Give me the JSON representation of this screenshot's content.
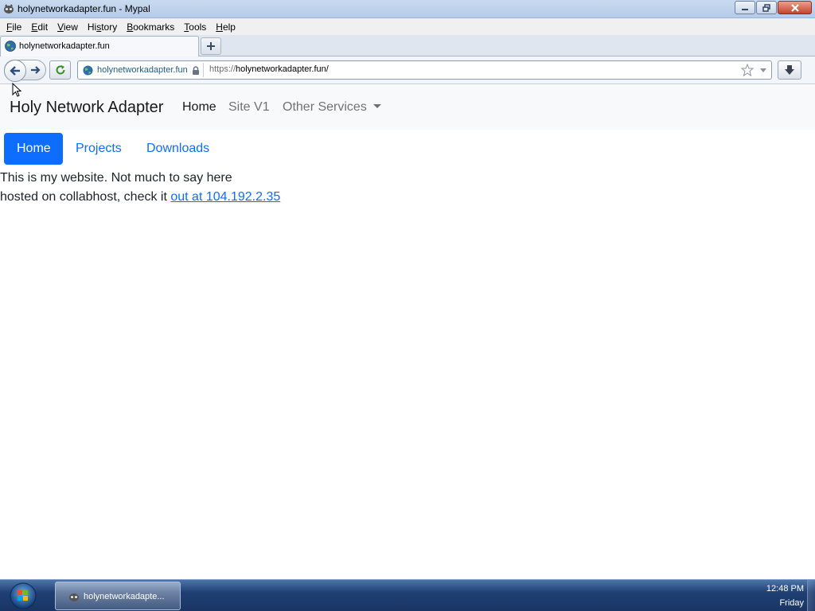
{
  "window": {
    "title": "holynetworkadapter.fun - Mypal"
  },
  "menu": {
    "items": [
      {
        "first": "F",
        "rest": "ile"
      },
      {
        "first": "E",
        "rest": "dit"
      },
      {
        "first": "V",
        "rest": "iew"
      },
      {
        "first": "",
        "rest": "Hi",
        "ul": "s",
        "tail": "tory"
      },
      {
        "first": "B",
        "rest": "ookmarks"
      },
      {
        "first": "T",
        "rest": "ools"
      },
      {
        "first": "H",
        "rest": "elp"
      }
    ]
  },
  "tab": {
    "label": "holynetworkadapter.fun"
  },
  "urlbar": {
    "identity_host": "holynetworkadapter.fun",
    "scheme": "https://",
    "rest": "holynetworkadapter.fun/"
  },
  "site": {
    "brand": "Holy Network Adapter",
    "nav": {
      "home": "Home",
      "site_v1": "Site V1",
      "other_services": "Other Services"
    },
    "pills": {
      "home": "Home",
      "projects": "Projects",
      "downloads": "Downloads"
    },
    "line1": "This is my website. Not much to say here",
    "line2_prefix": "hosted on collabhost, check it ",
    "line2_link": "out at 104.192.2.35"
  },
  "taskbar": {
    "task_label": "holynetworkadapte...",
    "time": "12:48 PM",
    "day": "Friday"
  },
  "colors": {
    "primary": "#0d6efd",
    "navbar_bg": "#f8f9fa"
  }
}
